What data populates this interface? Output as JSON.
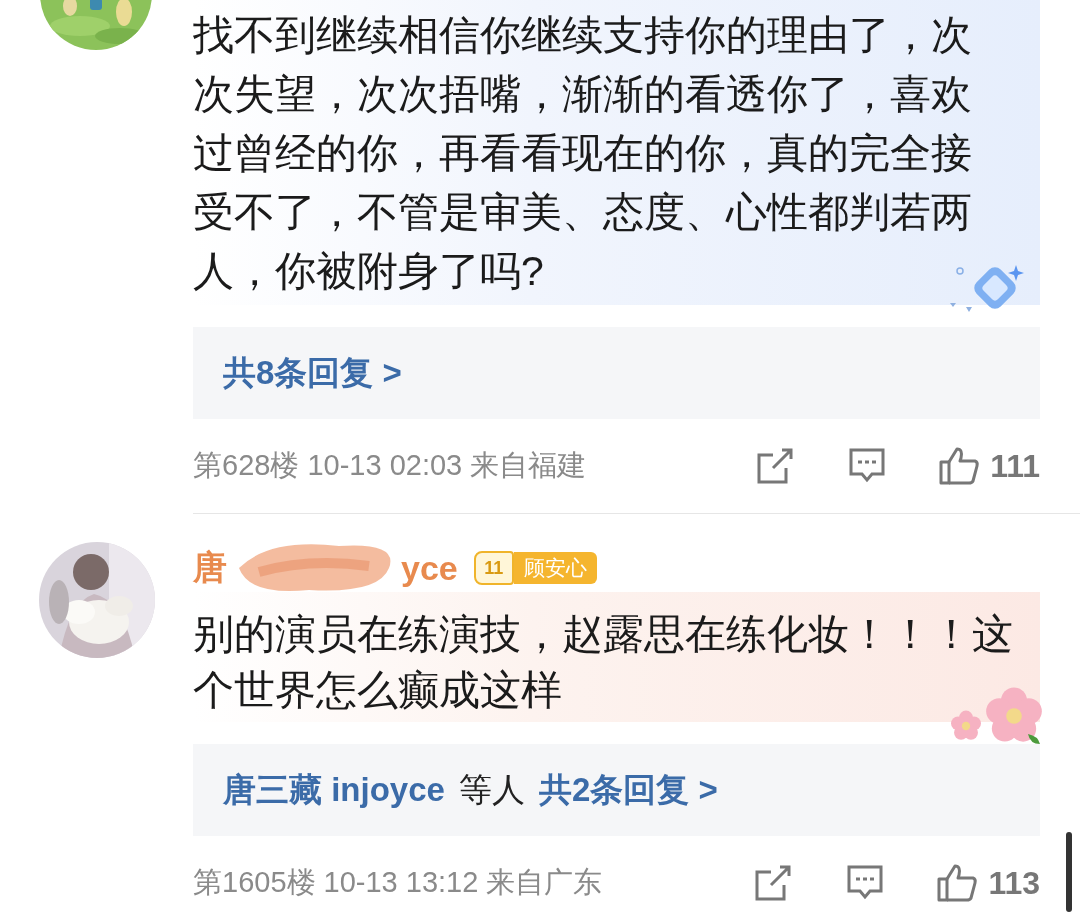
{
  "comments": [
    {
      "avatar": {
        "kind": "picture"
      },
      "kind": "blue",
      "text": "找不到继续相信你继续支持你的理由了，次次失望，次次捂嘴，渐渐的看透你了，喜欢过曾经的你，再看看现在的你，真的完全接受不了，不管是审美、态度、心性都判若两人，你被附身了吗?",
      "replies": [
        {
          "kind": "link",
          "text": "共8条回复 >"
        }
      ],
      "meta": "第628楼 10-13 02:03 来自福建",
      "likes": "111"
    },
    {
      "avatar": {
        "kind": "picture"
      },
      "kind": "pink",
      "user": {
        "name_start": "唐",
        "name_end": "yce",
        "badge_rank": "11",
        "badge_label": "顾安心"
      },
      "text": "别的演员在练演技，赵露思在练化妆！！！这个世界怎么癫成这样",
      "replies": [
        {
          "kind": "link",
          "text": "唐三藏 injoyce"
        },
        {
          "kind": "plain",
          "text": "等人"
        },
        {
          "kind": "link",
          "text": "共2条回复 >"
        }
      ],
      "meta": "第1605楼 10-13 13:12 来自广东",
      "likes": "113"
    }
  ]
}
